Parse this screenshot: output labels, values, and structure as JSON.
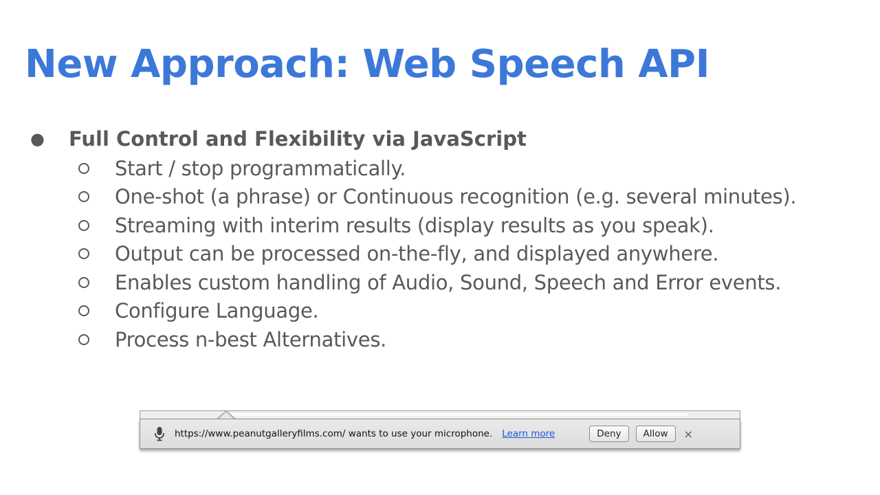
{
  "slide": {
    "title": "New Approach: Web Speech API",
    "main_bullet": "Full Control and Flexibility via JavaScript",
    "sub_bullets": [
      "Start / stop programmatically.",
      "One-shot (a phrase) or Continuous recognition (e.g. several minutes).",
      "Streaming with interim results  (display results as you speak).",
      "Output can be processed on-the-fly, and displayed anywhere.",
      "Enables custom handling of Audio, Sound, Speech and Error events.",
      "Configure Language.",
      "Process n-best Alternatives."
    ]
  },
  "infobar": {
    "icon": "microphone-icon",
    "message": "https://www.peanutgalleryfilms.com/ wants to use your microphone.",
    "learn_more": "Learn more",
    "deny_label": "Deny",
    "allow_label": "Allow",
    "close_glyph": "×"
  },
  "colors": {
    "title": "#3c78d8",
    "body_text": "#595959",
    "link": "#1a56db"
  }
}
